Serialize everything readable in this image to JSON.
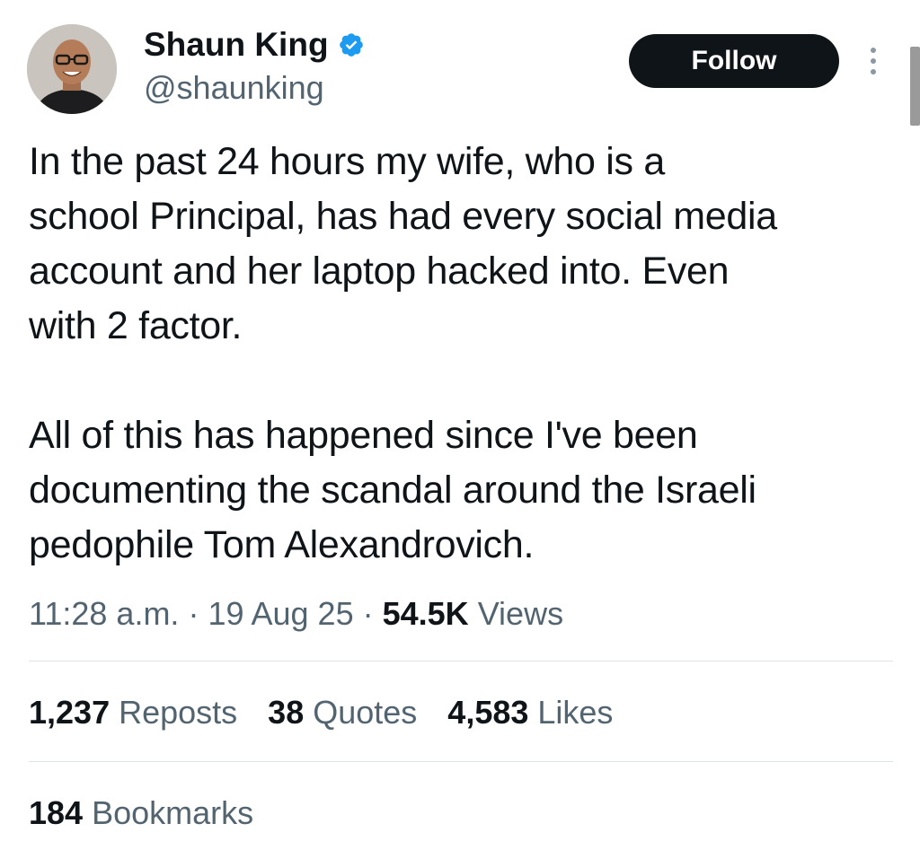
{
  "author": {
    "display_name": "Shaun King",
    "handle": "@shaunking",
    "verified_icon": "verified-badge-icon"
  },
  "actions": {
    "follow_label": "Follow",
    "more_icon": "more-vertical-icon"
  },
  "tweet": {
    "lines_para1": [
      "In the past 24 hours my wife, who is a",
      "school Principal, has had every social media",
      "account and her laptop hacked into. Even",
      "with 2 factor."
    ],
    "lines_para2": [
      "All of this has happened since I've been",
      "documenting the scandal around the Israeli",
      "pedophile Tom Alexandrovich."
    ]
  },
  "meta": {
    "time": "11:28 a.m.",
    "separator": " · ",
    "date": "19 Aug 25",
    "views_count": "54.5K",
    "views_label": " Views"
  },
  "stats": [
    {
      "count": "1,237",
      "label": " Reposts"
    },
    {
      "count": "38",
      "label": " Quotes"
    },
    {
      "count": "4,583",
      "label": " Likes"
    }
  ],
  "bookmarks": {
    "count": "184",
    "label": " Bookmarks"
  },
  "colors": {
    "text_primary": "#0f1419",
    "text_secondary": "#536471",
    "verified_blue": "#1d9bf0",
    "follow_bg": "#0f1419"
  }
}
